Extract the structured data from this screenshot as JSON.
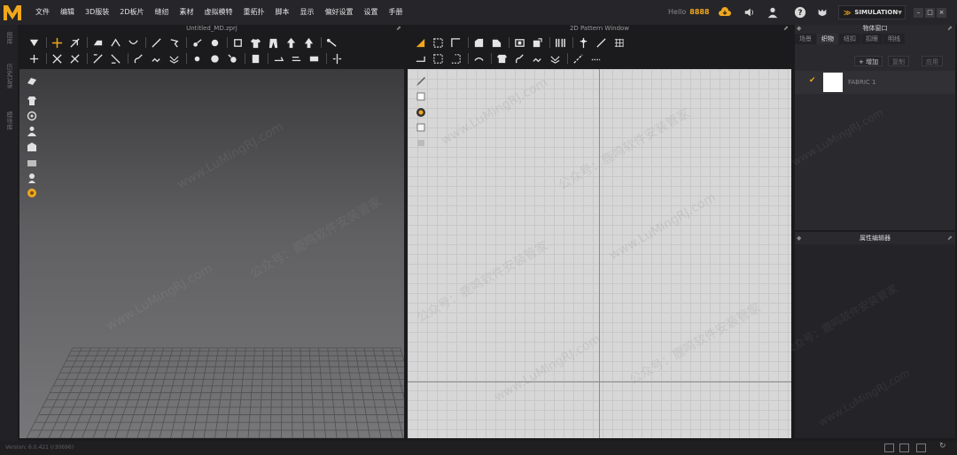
{
  "app": {
    "logo_letter": "M",
    "menu": [
      "文件",
      "编辑",
      "3D服装",
      "2D板片",
      "缝纫",
      "素材",
      "虚拟模特",
      "重拓扑",
      "脚本",
      "显示",
      "偏好设置",
      "设置",
      "手册"
    ],
    "hello_label": "Hello",
    "hello_user": "8888",
    "mode": "SIMULATION",
    "window_controls": [
      "–",
      "□",
      "×"
    ]
  },
  "sidebar": {
    "tabs": [
      "图库",
      "历史记录",
      "模块库"
    ]
  },
  "viewport3d": {
    "title": "Untitled_MD.zprj"
  },
  "pattern2d": {
    "title": "2D Pattern Window"
  },
  "object_browser": {
    "title": "物体窗口",
    "tabs": [
      {
        "label": "场景",
        "active": false
      },
      {
        "label": "织物",
        "active": true
      },
      {
        "label": "纽扣",
        "active": false
      },
      {
        "label": "扣眼",
        "active": false
      },
      {
        "label": "明线",
        "active": false
      }
    ],
    "add_button": "+ 增加",
    "copy_button": "复制",
    "apply_button": "应用",
    "fabric": {
      "name": "FABRIC 1",
      "swatch_color": "#ffffff",
      "checked": true
    }
  },
  "property_editor": {
    "title": "属性编辑器"
  },
  "status": {
    "version": "Version: 6.0.421 (r30696)"
  },
  "watermark": {
    "url": "www.LuMingRJ.com",
    "text": "公众号：鹿鸣软件安装管家"
  },
  "colors": {
    "accent": "#f0a71c",
    "menubar": "#26262a",
    "pattern_bg": "#d7d7d7"
  }
}
